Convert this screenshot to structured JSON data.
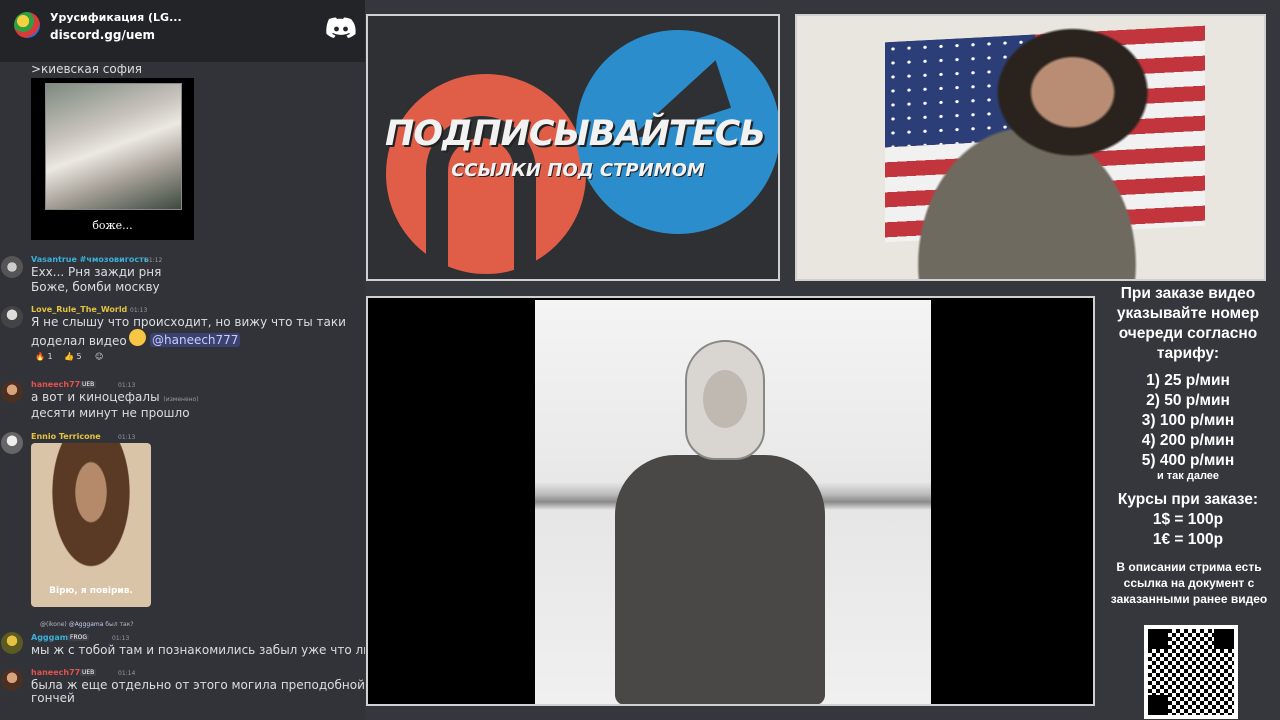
{
  "server": {
    "name": "Урусификация (LG...",
    "invite": "discord.gg/uem"
  },
  "chat": {
    "quote": ">киевская софия",
    "cat_caption": "боже...",
    "messages": [
      {
        "author": "Vasantrue #чмозовигость",
        "time": "01:12",
        "lines": [
          "Exх... Рня зажди рня",
          "Боже, бомби москву"
        ],
        "name_color": "#3ab0d9"
      },
      {
        "author": "Love_Rule_The_World",
        "time": "01:13",
        "lines": [
          "Я не слышу что происходит, но вижу что ты таки",
          "доделал видео"
        ],
        "mention": "@haneech777",
        "reactions": [
          "1",
          "5"
        ],
        "name_color": "#e3c341"
      },
      {
        "author": "haneech777",
        "badge": "UEB",
        "time": "01:13",
        "lines": [
          "а вот и киноцефалы",
          "десяти минут не прошло"
        ],
        "edited": "(изменено)",
        "name_color": "#e05252"
      },
      {
        "author": "Ennio Terricone",
        "time": "01:13",
        "image_caption": "Вірю, я повірив.",
        "name_color": "#e3c341"
      },
      {
        "reply_to": "@(ikone)",
        "reply_target": "@Agggama",
        "reply_text": "был так?",
        "author": "Agggama",
        "badge": "FROG",
        "time": "01:13",
        "lines": [
          "мы ж с тобой там и познакомились забыл уже что ли"
        ],
        "name_color": "#3ab0d9"
      },
      {
        "author": "haneech777",
        "badge": "UEB",
        "time": "01:14",
        "lines": [
          "была ж еще отдельно от этого могила преподобной",
          "гончей"
        ],
        "name_color": "#e05252"
      }
    ]
  },
  "promo": {
    "title": "ПОДПИСЫВАЙТЕСЬ",
    "subtitle": "ССЫЛКИ ПОД СТРИМОМ"
  },
  "info": {
    "header": "При заказе видео указывайте номер очереди согласно тарифу:",
    "tariffs": [
      "1) 25 р/мин",
      "2) 50 р/мин",
      "3) 100 р/мин",
      "4) 200 р/мин",
      "5) 400 р/мин"
    ],
    "and_so_on": "и так далее",
    "rates_title": "Курсы при заказе:",
    "rates": [
      "1$ = 100р",
      "1€ = 100р"
    ],
    "note": "В описании стрима есть ссылка на документ с заказанными ранее видео"
  }
}
